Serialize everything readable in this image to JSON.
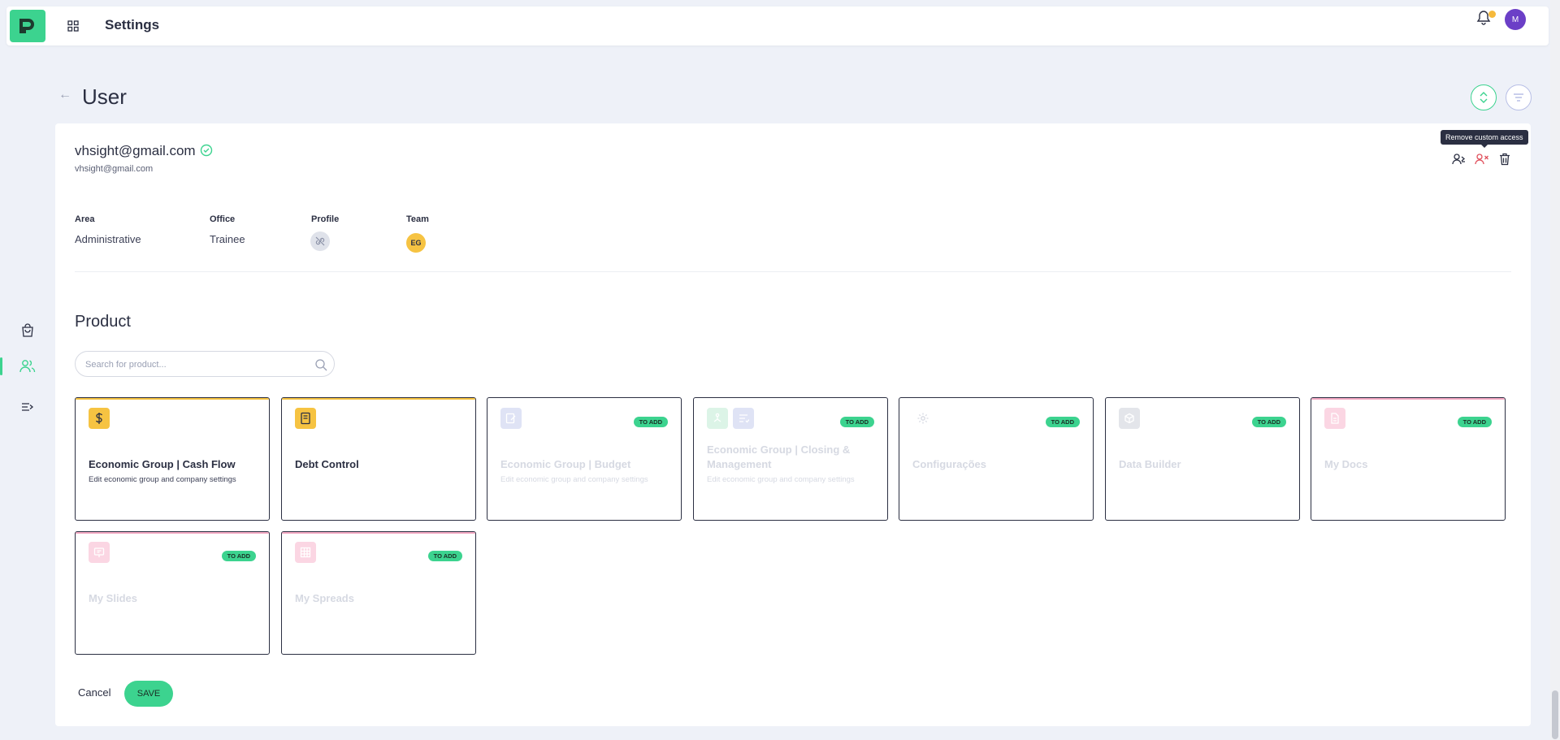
{
  "topbar": {
    "title": "Settings",
    "avatar_initial": "M",
    "notification_dot_color": "#f6b93b"
  },
  "sidebar": {
    "items": [
      {
        "icon": "bag-icon",
        "active": false
      },
      {
        "icon": "users-icon",
        "active": true
      },
      {
        "icon": "expand-menu-icon",
        "active": false
      }
    ]
  },
  "page": {
    "title": "User"
  },
  "user": {
    "email": "vhsight@gmail.com",
    "email_secondary": "vhsight@gmail.com",
    "verified": true
  },
  "actions": {
    "tooltip": "Remove custom access"
  },
  "meta": {
    "area_label": "Area",
    "area_value": "Administrative",
    "office_label": "Office",
    "office_value": "Trainee",
    "profile_label": "Profile",
    "team_label": "Team",
    "team_value": "EG"
  },
  "product": {
    "title": "Product",
    "search_placeholder": "Search for product...",
    "badge_label": "TO ADD",
    "items": [
      {
        "name": "Economic Group | Cash Flow",
        "description": "Edit economic group and company settings",
        "enabled": true,
        "icon": "dollar-icon"
      },
      {
        "name": "Debt Control",
        "description": "",
        "enabled": true,
        "icon": "ledger-icon"
      },
      {
        "name": "Economic Group | Budget",
        "description": "Edit economic group and company settings",
        "enabled": false,
        "icon": "edit-doc-icon"
      },
      {
        "name": "Economic Group | Closing & Management",
        "description": "Edit economic group and company settings",
        "enabled": false,
        "icon": "org-chart-icon"
      },
      {
        "name": "Configurações",
        "description": "",
        "enabled": false,
        "icon": "gear-icon"
      },
      {
        "name": "Data Builder",
        "description": "",
        "enabled": false,
        "icon": "cube-icon"
      },
      {
        "name": "My Docs",
        "description": "",
        "enabled": false,
        "icon": "document-icon"
      },
      {
        "name": "My Slides",
        "description": "",
        "enabled": false,
        "icon": "slides-icon"
      },
      {
        "name": "My Spreads",
        "description": "",
        "enabled": false,
        "icon": "spreadsheet-icon"
      }
    ]
  },
  "footer": {
    "cancel_label": "Cancel",
    "save_label": "SAVE"
  },
  "colors": {
    "accent": "#3cd38f",
    "text": "#2b2f42",
    "background": "#eef1f8"
  }
}
